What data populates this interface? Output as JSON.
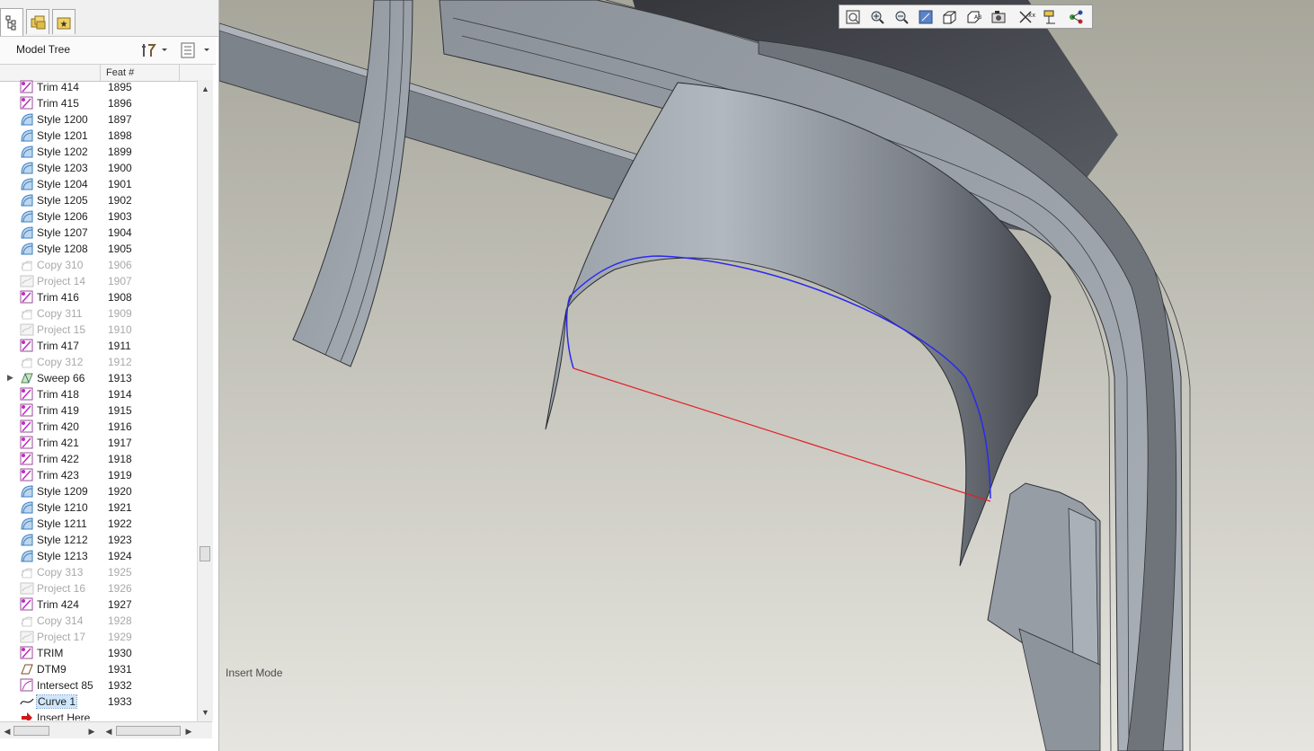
{
  "panel": {
    "title": "Model Tree",
    "columns": {
      "feat": "Feat #"
    }
  },
  "tree_rows": [
    {
      "name": "Trim 414",
      "feat": "1895",
      "icon": "trim-icon",
      "suppressed": false
    },
    {
      "name": "Trim 415",
      "feat": "1896",
      "icon": "trim-icon",
      "suppressed": false
    },
    {
      "name": "Style 1200",
      "feat": "1897",
      "icon": "style-icon",
      "suppressed": false
    },
    {
      "name": "Style 1201",
      "feat": "1898",
      "icon": "style-icon",
      "suppressed": false
    },
    {
      "name": "Style 1202",
      "feat": "1899",
      "icon": "style-icon",
      "suppressed": false
    },
    {
      "name": "Style 1203",
      "feat": "1900",
      "icon": "style-icon",
      "suppressed": false
    },
    {
      "name": "Style 1204",
      "feat": "1901",
      "icon": "style-icon",
      "suppressed": false
    },
    {
      "name": "Style 1205",
      "feat": "1902",
      "icon": "style-icon",
      "suppressed": false
    },
    {
      "name": "Style 1206",
      "feat": "1903",
      "icon": "style-icon",
      "suppressed": false
    },
    {
      "name": "Style 1207",
      "feat": "1904",
      "icon": "style-icon",
      "suppressed": false
    },
    {
      "name": "Style 1208",
      "feat": "1905",
      "icon": "style-icon",
      "suppressed": false
    },
    {
      "name": "Copy 310",
      "feat": "1906",
      "icon": "copy-icon",
      "suppressed": true
    },
    {
      "name": "Project 14",
      "feat": "1907",
      "icon": "project-icon",
      "suppressed": true
    },
    {
      "name": "Trim 416",
      "feat": "1908",
      "icon": "trim-icon",
      "suppressed": false
    },
    {
      "name": "Copy 311",
      "feat": "1909",
      "icon": "copy-icon",
      "suppressed": true
    },
    {
      "name": "Project 15",
      "feat": "1910",
      "icon": "project-icon",
      "suppressed": true
    },
    {
      "name": "Trim 417",
      "feat": "1911",
      "icon": "trim-icon",
      "suppressed": false
    },
    {
      "name": "Copy 312",
      "feat": "1912",
      "icon": "copy-icon",
      "suppressed": true
    },
    {
      "name": "Sweep 66",
      "feat": "1913",
      "icon": "sweep-icon",
      "suppressed": false,
      "expandable": true
    },
    {
      "name": "Trim 418",
      "feat": "1914",
      "icon": "trim-icon",
      "suppressed": false
    },
    {
      "name": "Trim 419",
      "feat": "1915",
      "icon": "trim-icon",
      "suppressed": false
    },
    {
      "name": "Trim 420",
      "feat": "1916",
      "icon": "trim-icon",
      "suppressed": false
    },
    {
      "name": "Trim 421",
      "feat": "1917",
      "icon": "trim-icon",
      "suppressed": false
    },
    {
      "name": "Trim 422",
      "feat": "1918",
      "icon": "trim-icon",
      "suppressed": false
    },
    {
      "name": "Trim 423",
      "feat": "1919",
      "icon": "trim-icon",
      "suppressed": false
    },
    {
      "name": "Style 1209",
      "feat": "1920",
      "icon": "style-icon",
      "suppressed": false
    },
    {
      "name": "Style 1210",
      "feat": "1921",
      "icon": "style-icon",
      "suppressed": false
    },
    {
      "name": "Style 1211",
      "feat": "1922",
      "icon": "style-icon",
      "suppressed": false
    },
    {
      "name": "Style 1212",
      "feat": "1923",
      "icon": "style-icon",
      "suppressed": false
    },
    {
      "name": "Style 1213",
      "feat": "1924",
      "icon": "style-icon",
      "suppressed": false
    },
    {
      "name": "Copy 313",
      "feat": "1925",
      "icon": "copy-icon",
      "suppressed": true
    },
    {
      "name": "Project 16",
      "feat": "1926",
      "icon": "project-icon",
      "suppressed": true
    },
    {
      "name": "Trim 424",
      "feat": "1927",
      "icon": "trim-icon",
      "suppressed": false
    },
    {
      "name": "Copy 314",
      "feat": "1928",
      "icon": "copy-icon",
      "suppressed": true
    },
    {
      "name": "Project 17",
      "feat": "1929",
      "icon": "project-icon",
      "suppressed": true
    },
    {
      "name": "TRIM",
      "feat": "1930",
      "icon": "trim-icon",
      "suppressed": false
    },
    {
      "name": "DTM9",
      "feat": "1931",
      "icon": "datum-plane-icon",
      "suppressed": false
    },
    {
      "name": "Intersect 85",
      "feat": "1932",
      "icon": "intersect-icon",
      "suppressed": false
    },
    {
      "name": "Curve 1",
      "feat": "1933",
      "icon": "curve-icon",
      "suppressed": false,
      "selected": true
    },
    {
      "name": "Insert Here",
      "feat": "",
      "icon": "insert-arrow-icon",
      "suppressed": false
    }
  ],
  "status": {
    "mode": "Insert Mode"
  },
  "view_toolbar": [
    {
      "icon": "refit-icon"
    },
    {
      "icon": "zoom-in-icon"
    },
    {
      "icon": "zoom-out-icon"
    },
    {
      "icon": "repaint-icon"
    },
    {
      "icon": "display-style-icon"
    },
    {
      "icon": "saved-views-icon"
    },
    {
      "icon": "view-manager-icon"
    },
    {
      "icon": "datum-display-icon"
    },
    {
      "icon": "annotation-display-icon"
    },
    {
      "icon": "spin-center-icon"
    }
  ],
  "colors": {
    "viewport_bg_top": "#a7a69b",
    "viewport_bg_bottom": "#e6e5df",
    "selection_blue": "#2a2aee",
    "edge_red": "#e2202a",
    "trim_magenta": "#c02ac0",
    "style_blue": "#3d7fbf"
  }
}
